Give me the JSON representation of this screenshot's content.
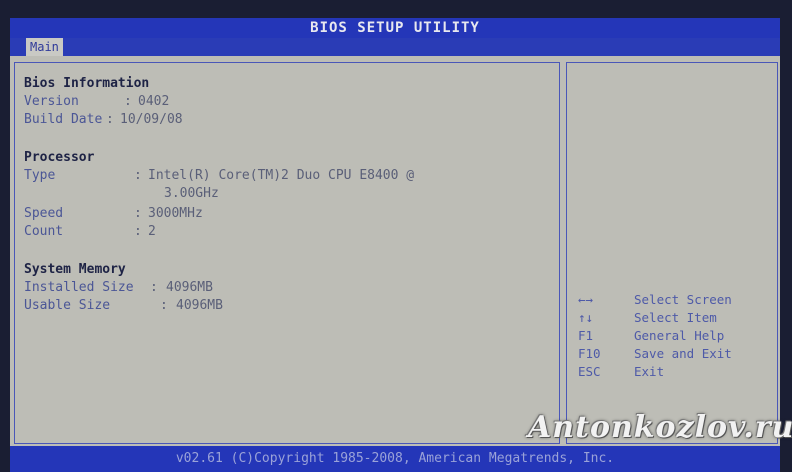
{
  "window": {
    "title": "BIOS SETUP UTILITY"
  },
  "tabs": [
    {
      "label": "Main"
    }
  ],
  "bios_information": {
    "heading": "Bios Information",
    "version": {
      "label": "Version",
      "sep": ":",
      "value": "0402"
    },
    "build_date": {
      "label": "Build Date",
      "sep": ":",
      "value": "10/09/08"
    }
  },
  "processor": {
    "heading": "Processor",
    "type": {
      "label": "Type",
      "sep": ":",
      "value": "Intel(R) Core(TM)2 Duo CPU E8400 @",
      "value_cont": "3.00GHz"
    },
    "speed": {
      "label": "Speed",
      "sep": ":",
      "value": "3000MHz"
    },
    "count": {
      "label": "Count",
      "sep": ":",
      "value": "2"
    }
  },
  "system_memory": {
    "heading": "System Memory",
    "installed": {
      "label": "Installed Size",
      "sep": ":",
      "value": "4096MB"
    },
    "usable": {
      "label": "Usable Size",
      "sep": ":",
      "value": "4096MB"
    }
  },
  "help": [
    {
      "key": "←→",
      "desc": "Select Screen"
    },
    {
      "key": "↑↓",
      "desc": "Select Item"
    },
    {
      "key": "F1",
      "desc": "General Help"
    },
    {
      "key": "F10",
      "desc": "Save and Exit"
    },
    {
      "key": "ESC",
      "desc": "Exit"
    }
  ],
  "footer": {
    "text": "v02.61 (C)Copyright 1985-2008, American Megatrends, Inc."
  },
  "watermark": {
    "text": "Antonkozlov.ru"
  },
  "colors": {
    "bar": "#2436b8",
    "panel": "#bdbdb6",
    "border": "#4a57b8",
    "help_text": "#4e5aa8"
  }
}
